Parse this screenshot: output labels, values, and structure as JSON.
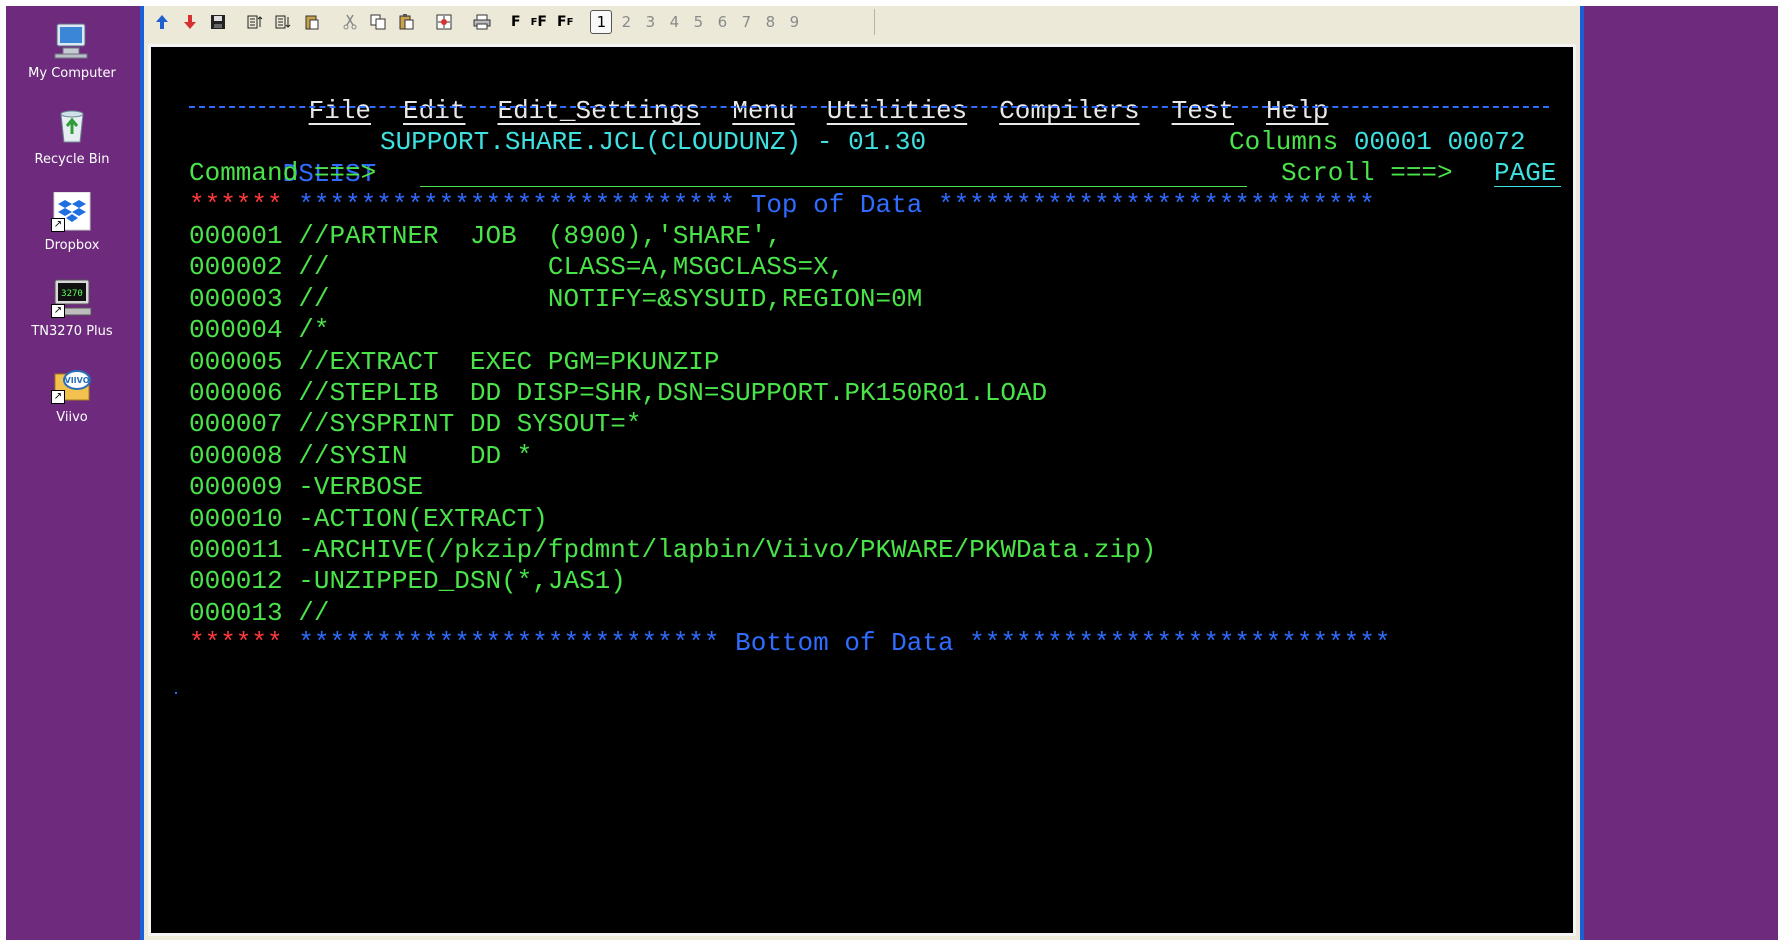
{
  "desktop": {
    "icons": [
      {
        "label": "My Computer",
        "icon": "computer-icon"
      },
      {
        "label": "Recycle Bin",
        "icon": "recycle-bin-icon"
      },
      {
        "label": "Dropbox",
        "icon": "dropbox-icon"
      },
      {
        "label": "TN3270 Plus",
        "icon": "terminal-app-icon",
        "glyph_text": "3270"
      },
      {
        "label": "Viivo",
        "icon": "viivo-folder-icon",
        "glyph_text": "VIIVO"
      }
    ]
  },
  "toolbar": {
    "buttons": [
      "arrow-up-icon",
      "arrow-down-icon",
      "save-icon",
      "align-icon-1",
      "align-icon-2",
      "clipboard-icon",
      "cut-icon",
      "copy-icon",
      "paste-icon",
      "target-icon",
      "print-icon"
    ],
    "font_buttons": [
      "F",
      "F",
      "F",
      "F",
      "F",
      "F",
      "F"
    ],
    "sessions": [
      "1",
      "2",
      "3",
      "4",
      "5",
      "6",
      "7",
      "8",
      "9"
    ],
    "active_session": "1"
  },
  "terminal": {
    "menu": [
      "File",
      "Edit",
      "Edit_Settings",
      "Menu",
      "Utilities",
      "Compilers",
      "Test",
      "Help"
    ],
    "header": {
      "panel": "DSLIST",
      "dataset": "SUPPORT.SHARE.JCL(CLOUDUNZ) - 01.30",
      "columns_label": "Columns",
      "columns_from": "00001",
      "columns_to": "00072"
    },
    "command": {
      "label": "Command ===>",
      "value": "",
      "scroll_label": "Scroll ===>",
      "scroll_value": "PAGE"
    },
    "top_marker": {
      "prefix": "******",
      "left_stars": "****************************",
      "text": "Top of Data",
      "right_stars": "****************************"
    },
    "lines": [
      {
        "num": "000001",
        "text": "//PARTNER  JOB  (8900),'SHARE',"
      },
      {
        "num": "000002",
        "text": "//              CLASS=A,MSGCLASS=X,"
      },
      {
        "num": "000003",
        "text": "//              NOTIFY=&SYSUID,REGION=0M"
      },
      {
        "num": "000004",
        "text": "/*"
      },
      {
        "num": "000005",
        "text": "//EXTRACT  EXEC PGM=PKUNZIP"
      },
      {
        "num": "000006",
        "text": "//STEPLIB  DD DISP=SHR,DSN=SUPPORT.PK150R01.LOAD"
      },
      {
        "num": "000007",
        "text": "//SYSPRINT DD SYSOUT=*"
      },
      {
        "num": "000008",
        "text": "//SYSIN    DD *"
      },
      {
        "num": "000009",
        "text": "-VERBOSE"
      },
      {
        "num": "000010",
        "text": "-ACTION(EXTRACT)"
      },
      {
        "num": "000011",
        "text": "-ARCHIVE(/pkzip/fpdmnt/lapbin/Viivo/PKWARE/PKWData.zip)"
      },
      {
        "num": "000012",
        "text": "-UNZIPPED_DSN(*,JAS1)"
      },
      {
        "num": "000013",
        "text": "//"
      }
    ],
    "bottom_marker": {
      "prefix": "******",
      "left_stars": "***************************",
      "text": "Bottom of Data",
      "right_stars": "***************************"
    }
  },
  "colors": {
    "desktop_bg": "#6e2b7d",
    "terminal_bg": "#000000",
    "text_green": "#4ae34a",
    "text_cyan": "#3ee0e0",
    "text_blue": "#2f6cff",
    "text_red": "#ff3a3a",
    "window_frame": "#1b5fd6"
  }
}
